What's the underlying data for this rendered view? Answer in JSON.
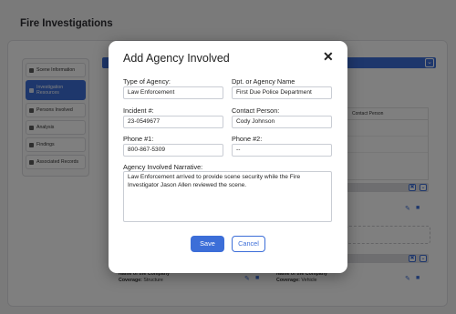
{
  "page": {
    "title": "Fire Investigations"
  },
  "sidebar": {
    "items": [
      {
        "label": "Scene Information"
      },
      {
        "label": "Investigation Resources"
      },
      {
        "label": "Persons Involved"
      },
      {
        "label": "Analysis"
      },
      {
        "label": "Findings"
      },
      {
        "label": "Associated Records"
      }
    ]
  },
  "background": {
    "contact_header": "Contact Person",
    "companies": [
      {
        "name": "Name of the Company",
        "coverage_label": "Coverage:",
        "coverage": "Structure"
      },
      {
        "name": "Name of the Company",
        "coverage_label": "Coverage:",
        "coverage": "Vehicle"
      }
    ]
  },
  "modal": {
    "title": "Add Agency Involved",
    "fields": {
      "type_of_agency": {
        "label": "Type of Agency:",
        "value": "Law Enforcement"
      },
      "dept_name": {
        "label": "Dpt. or Agency Name",
        "value": "First Due Police Department"
      },
      "incident": {
        "label": "Incident #:",
        "value": "23-0549677"
      },
      "contact_person": {
        "label": "Contact Person:",
        "value": "Cody Johnson"
      },
      "phone1": {
        "label": "Phone #1:",
        "value": "800-867-5309"
      },
      "phone2": {
        "label": "Phone #2:",
        "value": "--"
      },
      "narrative": {
        "label": "Agency Involved Narrative:",
        "value": "Law Enforcement arrived to provide scene security while the Fire Investigator Jason Allen reviewed the scene."
      }
    },
    "save_label": "Save",
    "cancel_label": "Cancel"
  },
  "colors": {
    "accent": "#3c6ed8",
    "overlay": "rgba(0,0,0,0.5)"
  },
  "icons": [
    "close-icon",
    "chevron-down-icon",
    "edit-icon",
    "delete-icon",
    "expand-icon"
  ]
}
